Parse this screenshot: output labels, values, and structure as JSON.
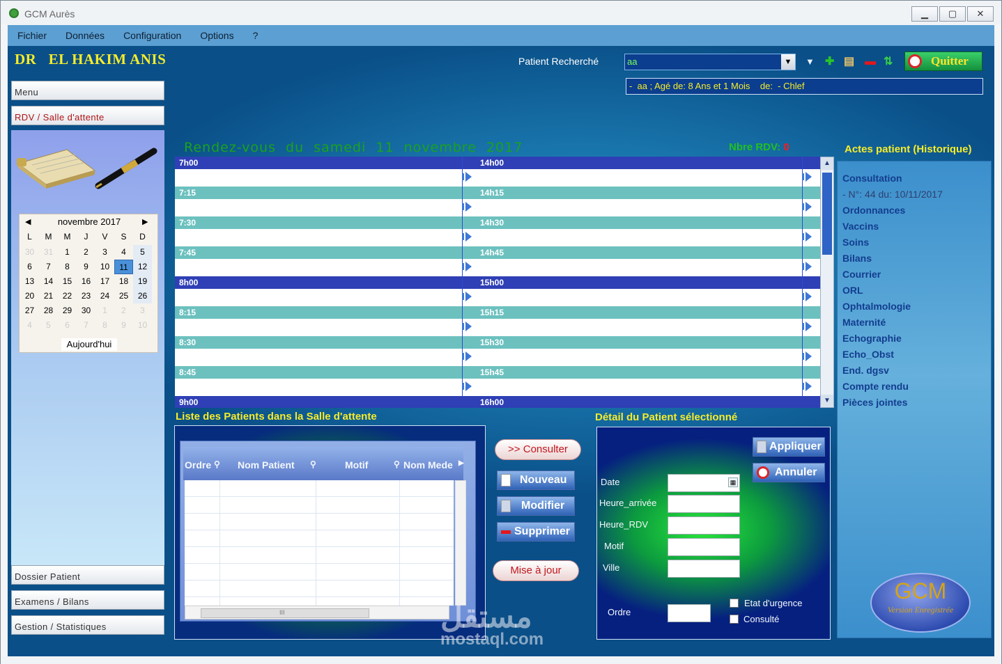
{
  "window": {
    "title": "GCM Aurès",
    "minimize": "▁",
    "maximize": "▢",
    "close": "✕"
  },
  "menu": [
    "Fichier",
    "Données",
    "Configuration",
    "Options",
    "?"
  ],
  "doctor": "DR   EL HAKIM ANIS",
  "search": {
    "label": "Patient Recherché",
    "value": "aa"
  },
  "toolbar_icons": [
    "dropdown-arrow-icon",
    "add-icon",
    "card-icon",
    "remove-icon",
    "swap-icon"
  ],
  "quit_label": "Quitter",
  "patient_info": "-  aa ; Agé de: 8 Ans et 1 Mois    de:  - Chlef",
  "left_nav": {
    "menu": "Menu",
    "rdv": "RDV / Salle d'attente",
    "dossier": "Dossier Patient",
    "examens": "Examens / Bilans",
    "gestion": "Gestion / Statistiques"
  },
  "calendar": {
    "month": "novembre 2017",
    "days": [
      "L",
      "M",
      "M",
      "J",
      "V",
      "S",
      "D"
    ],
    "weeks": [
      [
        "30",
        "31",
        "1",
        "2",
        "3",
        "4",
        "5"
      ],
      [
        "6",
        "7",
        "8",
        "9",
        "10",
        "11",
        "12"
      ],
      [
        "13",
        "14",
        "15",
        "16",
        "17",
        "18",
        "19"
      ],
      [
        "20",
        "21",
        "22",
        "23",
        "24",
        "25",
        "26"
      ],
      [
        "27",
        "28",
        "29",
        "30",
        "1",
        "2",
        "3"
      ],
      [
        "4",
        "5",
        "6",
        "7",
        "8",
        "9",
        "10"
      ]
    ],
    "selected": "11",
    "today": "Aujourd'hui"
  },
  "schedule": {
    "title": "Rendez-vous  du  samedi  11  novembre  2017",
    "count_label": "Nbre RDV:",
    "count": "0",
    "left_slots": [
      "7h00",
      "7:15",
      "7:30",
      "7:45",
      "8h00",
      "8:15",
      "8:30",
      "8:45",
      "9h00"
    ],
    "right_slots": [
      "14h00",
      "14h15",
      "14h30",
      "14h45",
      "15h00",
      "15h15",
      "15h30",
      "15h45",
      "16h00"
    ]
  },
  "actes": {
    "title": "Actes patient (Historique)",
    "items": [
      "Consultation",
      "- N°: 44 du: 10/11/2017",
      "Ordonnances",
      "Vaccins",
      "Soins",
      "Bilans",
      "Courrier",
      "ORL",
      "Ophtalmologie",
      "Maternité",
      "Echographie",
      "Echo_Obst",
      "End. dgsv",
      "Compte rendu",
      "Pièces jointes"
    ]
  },
  "waiting": {
    "title": "Liste des Patients dans la Salle d'attente",
    "columns": [
      "Ordre",
      "Nom Patient",
      "Motif",
      "Nom Mede"
    ],
    "scroll_grip": "III"
  },
  "actions": {
    "consulter": ">> Consulter",
    "nouveau": "Nouveau",
    "modifier": "Modifier",
    "supprimer": "Supprimer",
    "maj": "Mise à jour"
  },
  "detail": {
    "title": "Détail du Patient sélectionné",
    "appliquer": "Appliquer",
    "annuler": "Annuler",
    "date": "Date",
    "heure_arrivee": "Heure_arrivée",
    "heure_rdv": "Heure_RDV",
    "motif": "Motif",
    "ville": "Ville",
    "ordre": "Ordre",
    "urgence": "Etat d'urgence",
    "consulte": "Consulté"
  },
  "logo": {
    "name": "GCM",
    "subtitle": "Version Enregistrée"
  },
  "watermark": {
    "arabic": "مستقل",
    "site": "mostaql.com"
  }
}
